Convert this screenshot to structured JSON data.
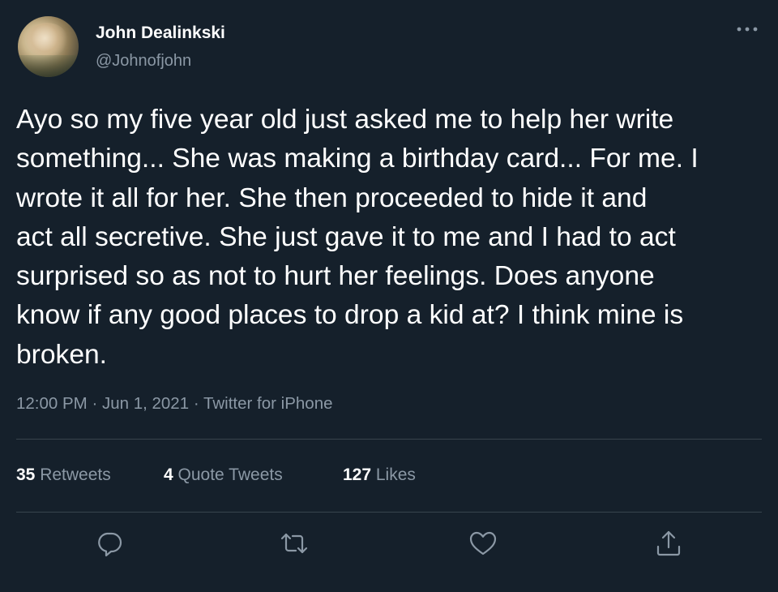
{
  "user": {
    "display_name": "John Dealinkski",
    "handle": "@Johnofjohn",
    "avatar_icon": "profile-photo"
  },
  "tweet": {
    "lines": [
      "Ayo so my five year old just asked me to help her write",
      "something... She was making a birthday card... For me. I",
      "wrote it all for her. She then proceeded to hide it and",
      "act all secretive. She just gave it to me and I had to act",
      "surprised so as not to hurt her feelings. Does anyone",
      "know if any good places to drop a kid at? I think mine is",
      "broken."
    ],
    "time": "12:00 PM",
    "date": "Jun 1, 2021",
    "source": "Twitter for iPhone",
    "separator": " · "
  },
  "stats": {
    "retweets_count": "35",
    "retweets_label": " Retweets",
    "quotes_count": "4",
    "quotes_label": " Quote Tweets",
    "likes_count": "127",
    "likes_label": " Likes"
  },
  "actions": {
    "icons": [
      "reply-icon",
      "retweet-icon",
      "like-icon",
      "share-icon"
    ]
  },
  "colors": {
    "background": "#15202b",
    "text": "#ffffff",
    "secondary_text": "#8b98a5",
    "divider": "#38444d"
  }
}
